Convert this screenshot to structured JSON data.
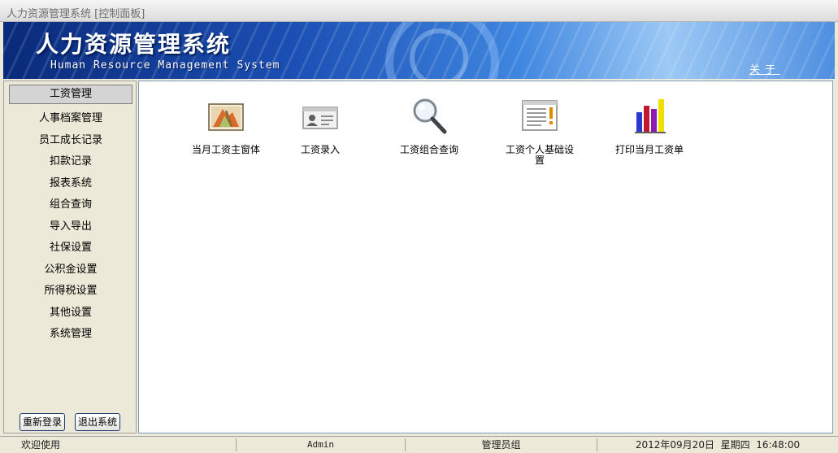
{
  "window": {
    "title": "人力资源管理系统 [控制面板]"
  },
  "banner": {
    "title_cn": "人力资源管理系统",
    "title_en": "Human Resource Management System",
    "about_link": "关于"
  },
  "sidebar": {
    "items": [
      {
        "label": "工资管理",
        "active": true
      },
      {
        "label": "人事档案管理"
      },
      {
        "label": "员工成长记录"
      },
      {
        "label": "扣款记录"
      },
      {
        "label": "报表系统"
      },
      {
        "label": "组合查询"
      },
      {
        "label": "导入导出"
      },
      {
        "label": "社保设置"
      },
      {
        "label": "公积金设置"
      },
      {
        "label": "所得税设置"
      },
      {
        "label": "其他设置"
      },
      {
        "label": "系统管理"
      }
    ],
    "relogin_button": "重新登录",
    "exit_button": "退出系统"
  },
  "content": {
    "tiles": [
      {
        "label": "当月工资主窗体",
        "icon": "payroll-window-icon"
      },
      {
        "label": "工资录入",
        "icon": "id-card-icon"
      },
      {
        "label": "工资组合查询",
        "icon": "magnifier-icon"
      },
      {
        "label": "工资个人基础设置",
        "icon": "settings-document-icon"
      },
      {
        "label": "打印当月工资单",
        "icon": "bar-chart-icon"
      }
    ]
  },
  "status": {
    "welcome": "欢迎使用",
    "user": "Admin",
    "group": "管理员组",
    "datetime": "2012年09月20日  星期四  16:48:00"
  }
}
